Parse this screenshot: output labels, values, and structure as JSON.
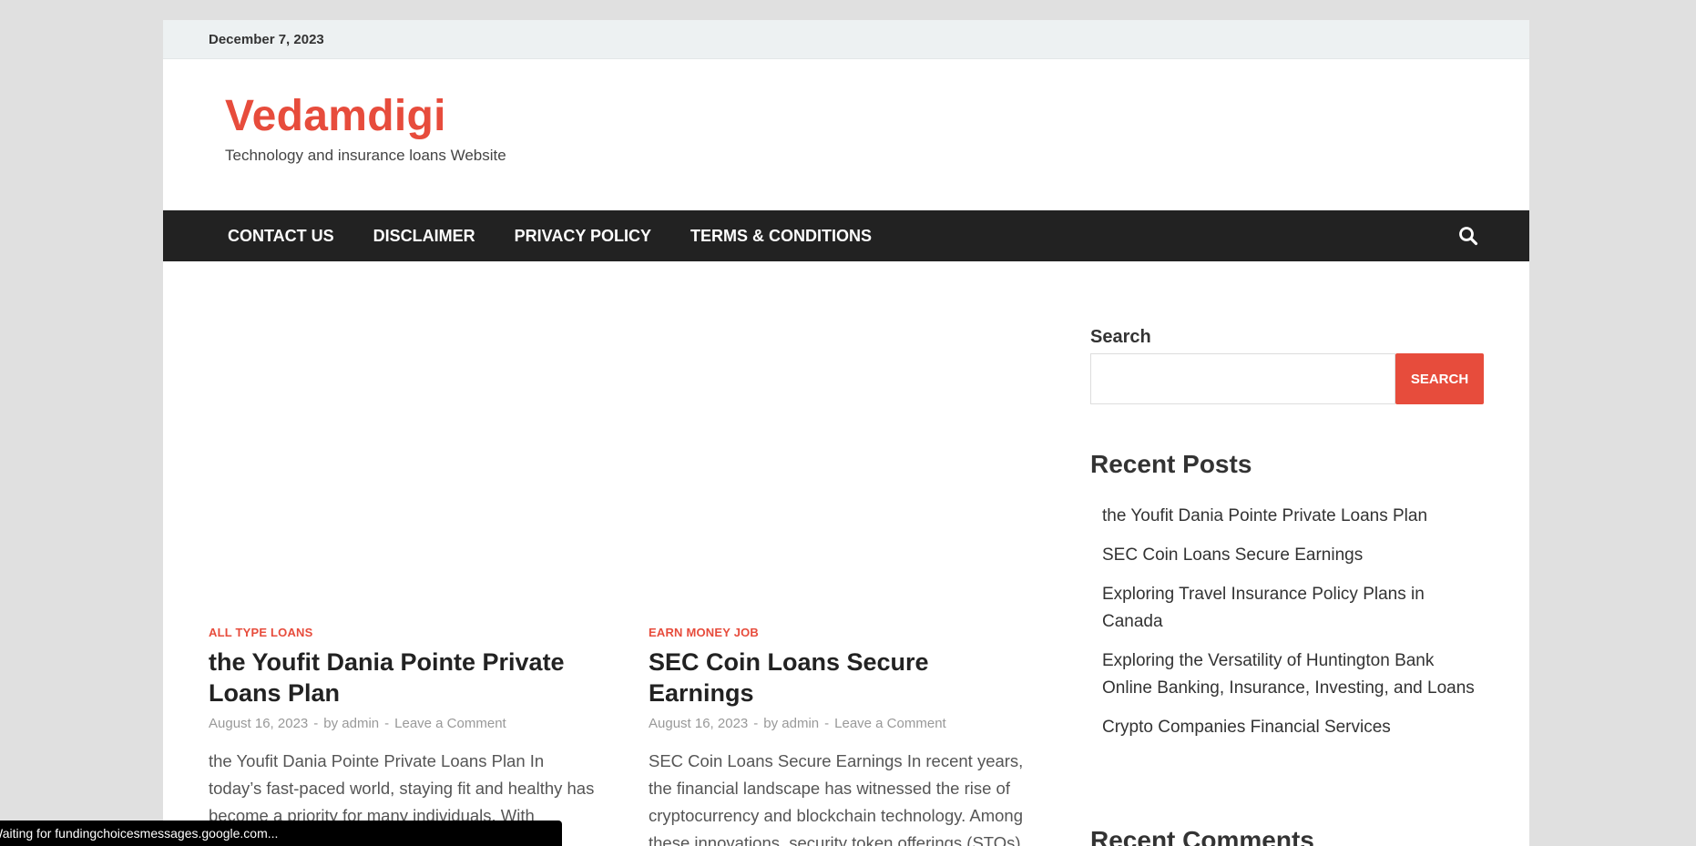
{
  "topbar": {
    "date": "December 7, 2023"
  },
  "site": {
    "title": "Vedamdigi",
    "tagline": "Technology and insurance loans Website"
  },
  "nav": {
    "items": [
      "CONTACT US",
      "DISCLAIMER",
      "PRIVACY POLICY",
      "TERMS & CONDITIONS"
    ],
    "search_icon": "search-icon"
  },
  "posts": [
    {
      "category": "ALL TYPE LOANS",
      "title": "the Youfit Dania Pointe Private Loans Plan",
      "date": "August 16, 2023",
      "author": "by admin",
      "comment_link": "Leave a Comment",
      "excerpt": "the Youfit Dania Pointe Private Loans Plan In today’s fast-paced world, staying fit and healthy has become a priority for many individuals. With"
    },
    {
      "category": "EARN MONEY JOB",
      "title": "SEC Coin Loans Secure Earnings",
      "date": "August 16, 2023",
      "author": "by admin",
      "comment_link": "Leave a Comment",
      "excerpt": "SEC Coin Loans Secure Earnings In recent years, the financial landscape has witnessed the rise of cryptocurrency and blockchain technology. Among these innovations, security token offerings (STOs) have gained significant …"
    }
  ],
  "meta_separator": "-",
  "sidebar": {
    "search_label": "Search",
    "search_value": "",
    "search_button": "SEARCH",
    "recent_posts_title": "Recent Posts",
    "recent_posts": [
      "the Youfit Dania Pointe Private Loans Plan",
      "SEC Coin Loans Secure Earnings",
      "Exploring Travel Insurance Policy Plans in Canada",
      "Exploring the Versatility of Huntington Bank Online Banking, Insurance, Investing, and Loans",
      "Crypto Companies Financial Services"
    ],
    "recent_comments_title": "Recent Comments"
  },
  "status_bar": {
    "text": "Waiting for fundingchoicesmessages.google.com..."
  },
  "colors": {
    "accent": "#e74c3c",
    "navbar": "#222222",
    "topbar": "#edf1f2",
    "page_bg": "#e0e0e0"
  }
}
